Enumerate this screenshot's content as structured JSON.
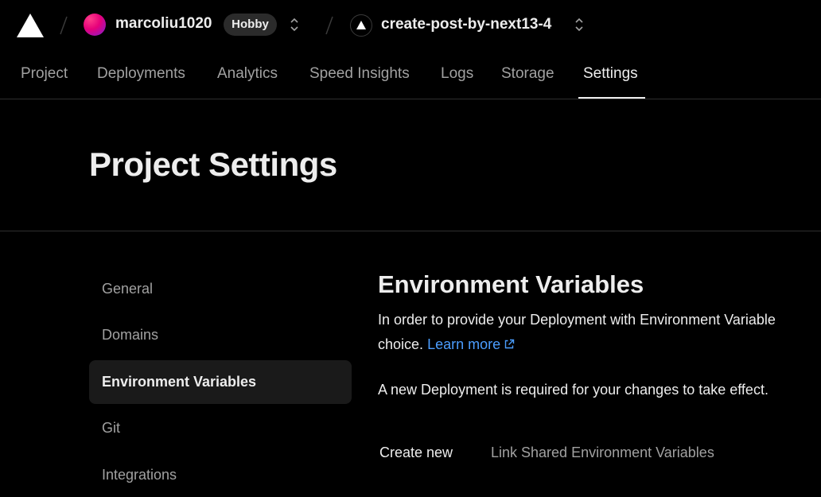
{
  "topbar": {
    "team_name": "marcoliu1020",
    "plan_badge": "Hobby",
    "project_name": "create-post-by-next13-4",
    "logo_icon": "vercel-triangle-icon",
    "switcher_icon": "chevron-up-down-icon"
  },
  "tabs": [
    {
      "label": "Project"
    },
    {
      "label": "Deployments"
    },
    {
      "label": "Analytics"
    },
    {
      "label": "Speed Insights"
    },
    {
      "label": "Logs"
    },
    {
      "label": "Storage"
    },
    {
      "label": "Settings",
      "active": true
    }
  ],
  "page": {
    "title": "Project Settings"
  },
  "sidebar": {
    "items": [
      {
        "label": "General"
      },
      {
        "label": "Domains"
      },
      {
        "label": "Environment Variables",
        "active": true
      },
      {
        "label": "Git"
      },
      {
        "label": "Integrations"
      }
    ]
  },
  "main": {
    "title": "Environment Variables",
    "description_line1": "In order to provide your Deployment with Environment Variable",
    "description_line2": "choice.",
    "learn_more": "Learn more",
    "notice": "A new Deployment is required for your changes to take effect.",
    "subtabs": [
      {
        "label": "Create new",
        "active": true
      },
      {
        "label": "Link Shared Environment Variables"
      }
    ]
  },
  "colors": {
    "background": "#000000",
    "text": "#ededed",
    "muted": "#a1a1a1",
    "link": "#4b9dff",
    "active_nav_bg": "#1a1a1a"
  }
}
